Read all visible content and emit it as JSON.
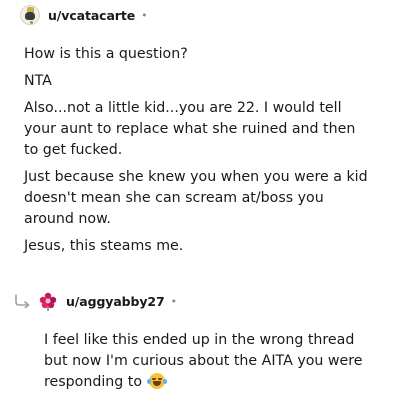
{
  "comments": [
    {
      "username": "u/vcatacarte",
      "separator": "•",
      "paragraphs": [
        "How is this a question?",
        "NTA",
        "Also...not a little kid...you are 22. I would tell your aunt to replace what she ruined and then to get fucked.",
        "Just because she knew you when you were a kid doesn't mean she can scream at/boss you around now.",
        "Jesus, this steams me."
      ]
    },
    {
      "username": "u/aggyabby27",
      "separator": "•",
      "paragraphs": [
        "I feel like this ended up in the wrong thread but now I'm curious about the AITA you were responding to"
      ],
      "emoji": "face-with-tears-of-joy"
    }
  ]
}
